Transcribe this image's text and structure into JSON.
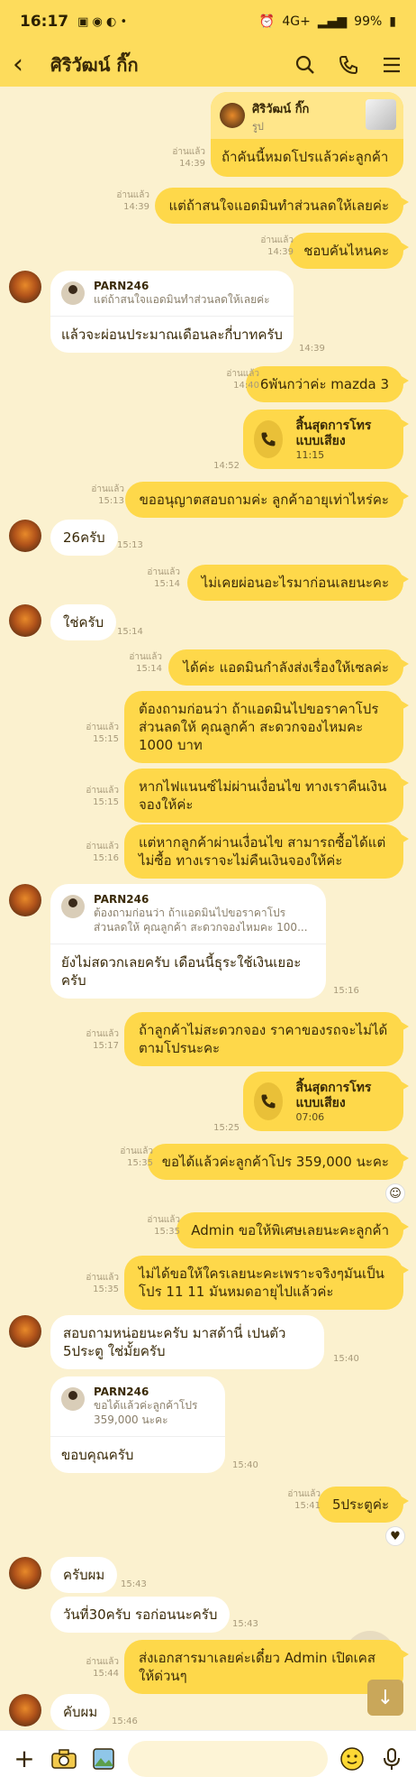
{
  "status_bar": {
    "time": "16:17",
    "battery": "99%",
    "signal": "4G+"
  },
  "header": {
    "title": "ศิริวัฒน์ กิ๊ก"
  },
  "messages": {
    "m1": {
      "name": "ศิริวัฒน์ กิ๊ก",
      "sub": "รูป",
      "text": "ถ้าคันนี้หมดโปรแล้วค่ะลูกค้า",
      "read": "อ่านแล้ว",
      "time": "14:39"
    },
    "m2": {
      "text": "แต่ถ้าสนใจแอดมินทำส่วนลดให้เลยค่ะ",
      "read": "อ่านแล้ว",
      "time": "14:39"
    },
    "m3": {
      "text": "ชอบคันไหนคะ",
      "read": "อ่านแล้ว",
      "time": "14:39"
    },
    "m4": {
      "reply_name": "PARN246",
      "reply_text": "แต่ถ้าสนใจแอดมินทำส่วนลดให้เลยค่ะ",
      "text": "แล้วจะผ่อนประมาณเดือนละกี่บาทครับ",
      "time": "14:39"
    },
    "m5": {
      "text": "6พันกว่าค่ะ mazda 3",
      "read": "อ่านแล้ว",
      "time": "14:40"
    },
    "m6": {
      "title": "สิ้นสุดการโทรแบบเสียง",
      "duration": "11:15",
      "time": "14:52"
    },
    "m7": {
      "text": "ขออนุญาตสอบถามค่ะ ลูกค้าอายุเท่าไหร่คะ",
      "read": "อ่านแล้ว",
      "time": "15:13"
    },
    "m8": {
      "text": "26ครับ",
      "time": "15:13"
    },
    "m9": {
      "text": "ไม่เคยผ่อนอะไรมาก่อนเลยนะคะ",
      "read": "อ่านแล้ว",
      "time": "15:14"
    },
    "m10": {
      "text": "ใช่ครับ",
      "time": "15:14"
    },
    "m11": {
      "text": "ได้ค่ะ แอดมินกำลังส่งเรื่องให้เซลค่ะ",
      "read": "อ่านแล้ว",
      "time": "15:14"
    },
    "m12": {
      "text": "ต้องถามก่อนว่า ถ้าแอดมินไปขอราคาโปรส่วนลดให้ คุณลูกค้า สะดวกจองไหมคะ 1000 บาท",
      "read": "อ่านแล้ว",
      "time": "15:15"
    },
    "m13": {
      "text": "หากไฟแนนซ์ไม่ผ่านเงื่อนไข ทางเราคืนเงินจองให้ค่ะ",
      "read": "อ่านแล้ว",
      "time": "15:15"
    },
    "m14": {
      "text": "แต่หากลูกค้าผ่านเงื่อนไข สามารถซื้อได้แต่ไม่ซื้อ ทางเราจะไม่คืนเงินจองให้ค่ะ",
      "read": "อ่านแล้ว",
      "time": "15:16"
    },
    "m15": {
      "reply_name": "PARN246",
      "reply_text": "ต้องถามก่อนว่า ถ้าแอดมินไปขอราคาโปรส่วนลดให้ คุณลูกค้า สะดวกจองไหมคะ 100...",
      "text": "ยังไม่สดวกเลยครับ เดือนนี้ธุระใช้เงินเยอะครับ",
      "time": "15:16"
    },
    "m16": {
      "text": "ถ้าลูกค้าไม่สะดวกจอง ราคาของรถจะไม่ได้ตามโปรนะคะ",
      "read": "อ่านแล้ว",
      "time": "15:17"
    },
    "m17": {
      "title": "สิ้นสุดการโทรแบบเสียง",
      "duration": "07:06",
      "time": "15:25"
    },
    "m18": {
      "text": "ขอได้แล้วค่ะลูกค้าโปร 359,000 นะคะ",
      "read": "อ่านแล้ว",
      "time": "15:35"
    },
    "m19": {
      "text": "Admin ขอให้พิเศษเลยนะคะลูกค้า",
      "read": "อ่านแล้ว",
      "time": "15:35"
    },
    "m20": {
      "text": "ไม่ได้ขอให้ใครเลยนะคะเพราะจริงๆมันเป็นโปร 11 11 มันหมดอายุไปแล้วค่ะ",
      "read": "อ่านแล้ว",
      "time": "15:35"
    },
    "m21": {
      "text": "สอบถามหน่อยนะครับ มาสด้านี่ เปนตัว 5ประตู ใช่มั้ยครับ",
      "time": "15:40"
    },
    "m22": {
      "reply_name": "PARN246",
      "reply_text": "ขอได้แล้วค่ะลูกค้าโปร 359,000 นะคะ",
      "text": "ขอบคุณครับ",
      "time": "15:40"
    },
    "m23": {
      "text": "5ประตูค่ะ",
      "read": "อ่านแล้ว",
      "time": "15:41"
    },
    "m24": {
      "text": "ครับผม",
      "time": "15:43"
    },
    "m25": {
      "text": "วันที่30ครับ รอก่อนนะครับ",
      "time": "15:43"
    },
    "m26": {
      "text": "ส่งเอกสารมาเลยค่ะเดี๋ยว Admin เปิดเคสให้ด่วนๆ",
      "read": "อ่านแล้ว",
      "time": "15:44"
    },
    "m27": {
      "text": "คับผม",
      "time": "15:46"
    }
  },
  "input": {
    "placeholder": ""
  },
  "colors": {
    "header_bg": "#FDDC5C",
    "chat_bg": "#FBF1CF",
    "bubble_out": "#FED84A",
    "bubble_in": "#FFFFFF"
  }
}
